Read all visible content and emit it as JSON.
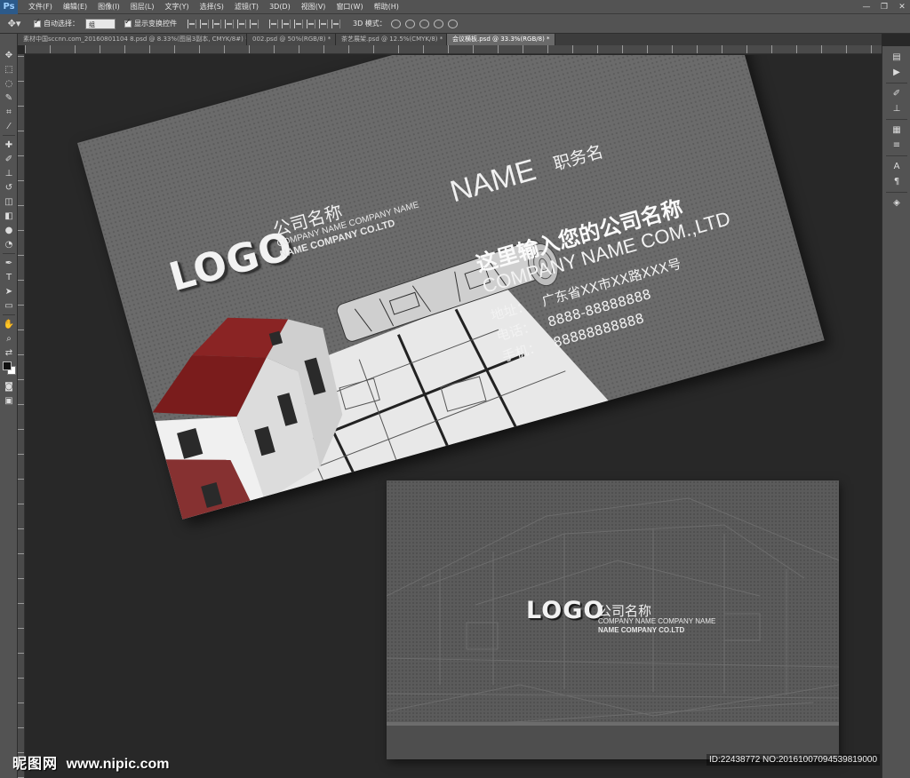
{
  "app": {
    "logo": "Ps"
  },
  "menu": {
    "items": [
      "文件(F)",
      "编辑(E)",
      "图像(I)",
      "图层(L)",
      "文字(Y)",
      "选择(S)",
      "滤镜(T)",
      "3D(D)",
      "视图(V)",
      "窗口(W)",
      "帮助(H)"
    ]
  },
  "window_controls": {
    "minimize": "—",
    "restore": "❐",
    "close": "✕"
  },
  "options": {
    "auto_select_label": "自动选择：",
    "auto_select_value": "组",
    "show_transform_label": "显示变换控件",
    "mode_3d_label": "3D 模式："
  },
  "tabs": [
    {
      "label": "素材中国sccnn.com_20160801104 8.psd @ 8.33%(图层3副本, CMYK/8#) *"
    },
    {
      "label": "002.psd @ 50%(RGB/8) *"
    },
    {
      "label": "茶艺展架.psd @ 12.5%(CMYK/8) *"
    },
    {
      "label": "会议横板.psd @ 33.3%(RGB/8) *"
    }
  ],
  "front_card": {
    "logo": "LOGO",
    "company_cn": "公司名称",
    "company_en_line1": "COMPANY NAME COMPANY NAME",
    "company_en_line2": "NAME COMPANY CO.LTD",
    "name": "NAME",
    "title": "职务名",
    "headline_cn": "这里输入您的公司名称",
    "headline_en": "COMPANY NAME COM.,LTD",
    "contacts": [
      {
        "label": "地址：",
        "value": "广东省XX市XX路XXX号"
      },
      {
        "label": "电话：",
        "value": "8888-88888888"
      },
      {
        "label": "手机：",
        "value": "88888888888"
      }
    ]
  },
  "back_card": {
    "logo": "LOGO",
    "company_cn": "公司名称",
    "company_en_line1": "COMPANY NAME COMPANY NAME",
    "company_en_line2": "NAME COMPANY CO.LTD"
  },
  "watermark": {
    "brand": "昵图网",
    "url": "www.nipic.com"
  },
  "image_id": "ID:22438772 NO:20161007094539819000",
  "colors": {
    "ui_panel": "#535353",
    "canvas_bg": "#282828",
    "card_gray": "#6b6b6b",
    "roof_red": "#7a1c1c"
  }
}
